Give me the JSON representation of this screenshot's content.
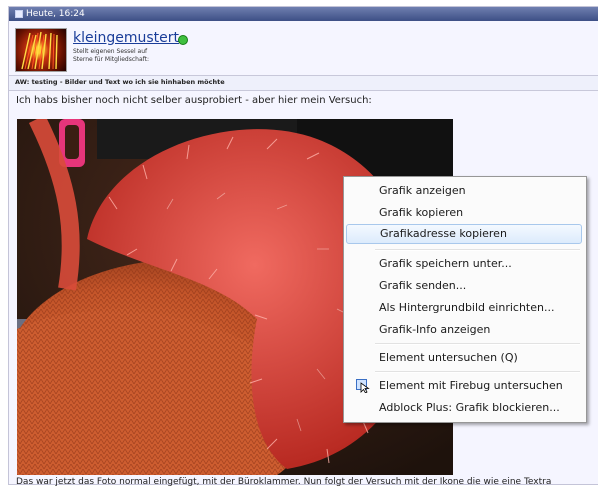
{
  "post": {
    "timestamp": "Heute, 16:24",
    "username": "kleingemustert",
    "user_title": "Stellt eigenen Sessel auf\nSterne für Mitgliedschaft: ",
    "subject": "AW: testing - Bilder und Text wo ich sie hinhaben möchte",
    "intro": "Ich habs bisher noch nicht selber ausprobiert - aber hier mein Versuch:",
    "caption": "Das war jetzt das Foto normal eingefügt, mit der Büroklammer. Nun folgt der Versuch mit der Ikone die wie eine Textra"
  },
  "context_menu": {
    "items": [
      {
        "label": "Grafik anzeigen"
      },
      {
        "label": "Grafik kopieren"
      },
      {
        "label": "Grafikadresse kopieren",
        "highlighted": true
      },
      {
        "label": "Grafik speichern unter..."
      },
      {
        "label": "Grafik senden..."
      },
      {
        "label": "Als Hintergrundbild einrichten..."
      },
      {
        "label": "Grafik-Info anzeigen"
      },
      {
        "label": "Element untersuchen (Q)"
      },
      {
        "label": "Element mit Firebug untersuchen",
        "icon": "firebug-icon"
      },
      {
        "label": "Adblock Plus: Grafik blockieren..."
      }
    ]
  },
  "colors": {
    "header_bg": "#3d4f85",
    "link": "#1a3d99",
    "online": "#3fbf3f",
    "menu_highlight": "#dcebfc"
  }
}
